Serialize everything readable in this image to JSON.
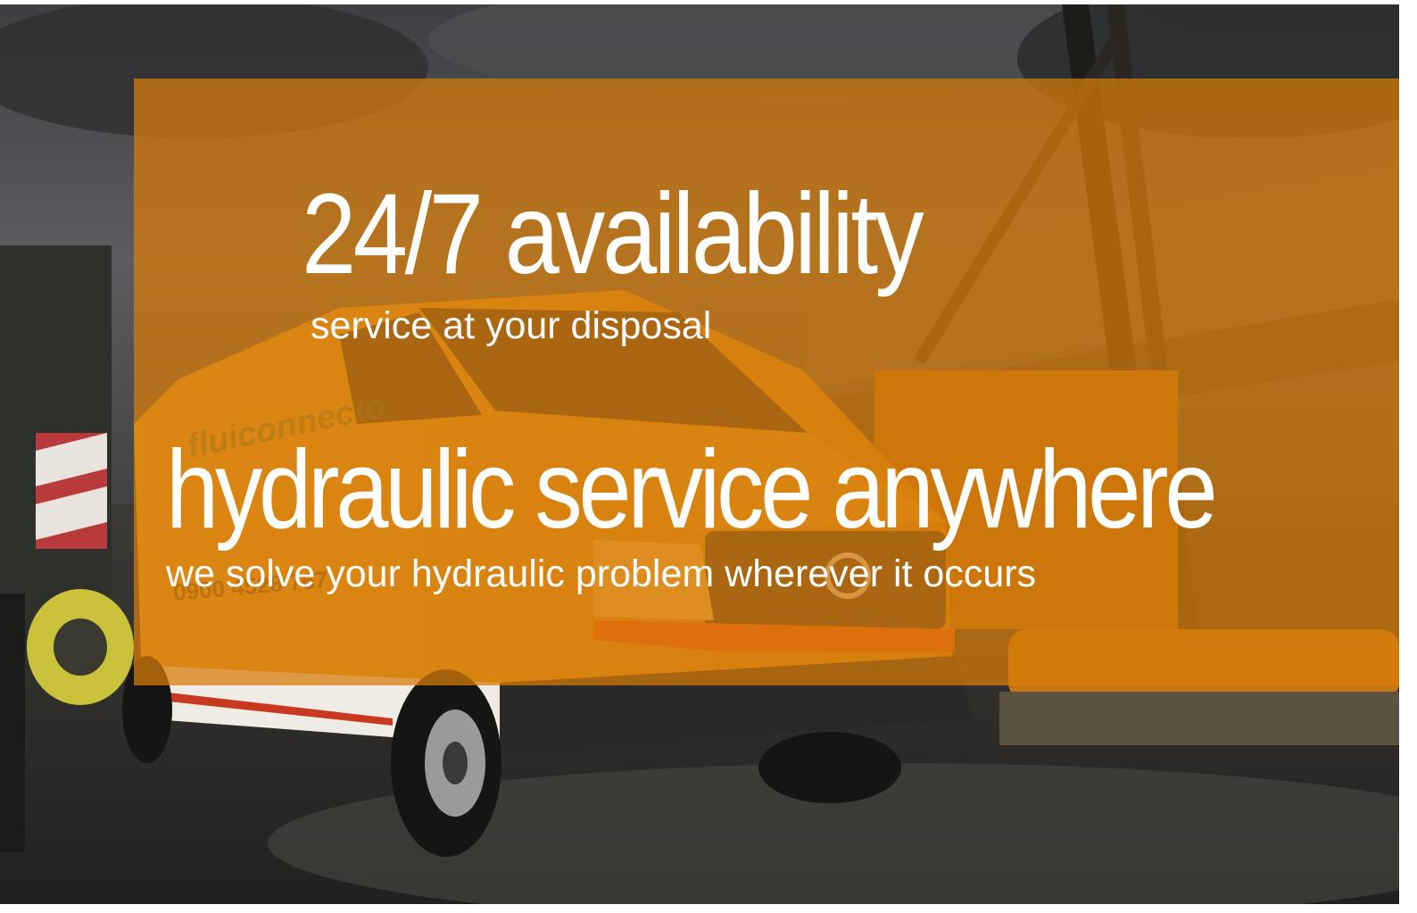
{
  "hero": {
    "headline_1": "24/7 availability",
    "subline_1": "service at your disposal",
    "headline_2": "hydraulic service anywhere",
    "subline_2": "we solve your hydraulic problem wherever it occurs",
    "overlay_color": "#d67c0a",
    "van_logo_text": "fluiconnecto",
    "van_phone_text": "0900 4528 767"
  }
}
